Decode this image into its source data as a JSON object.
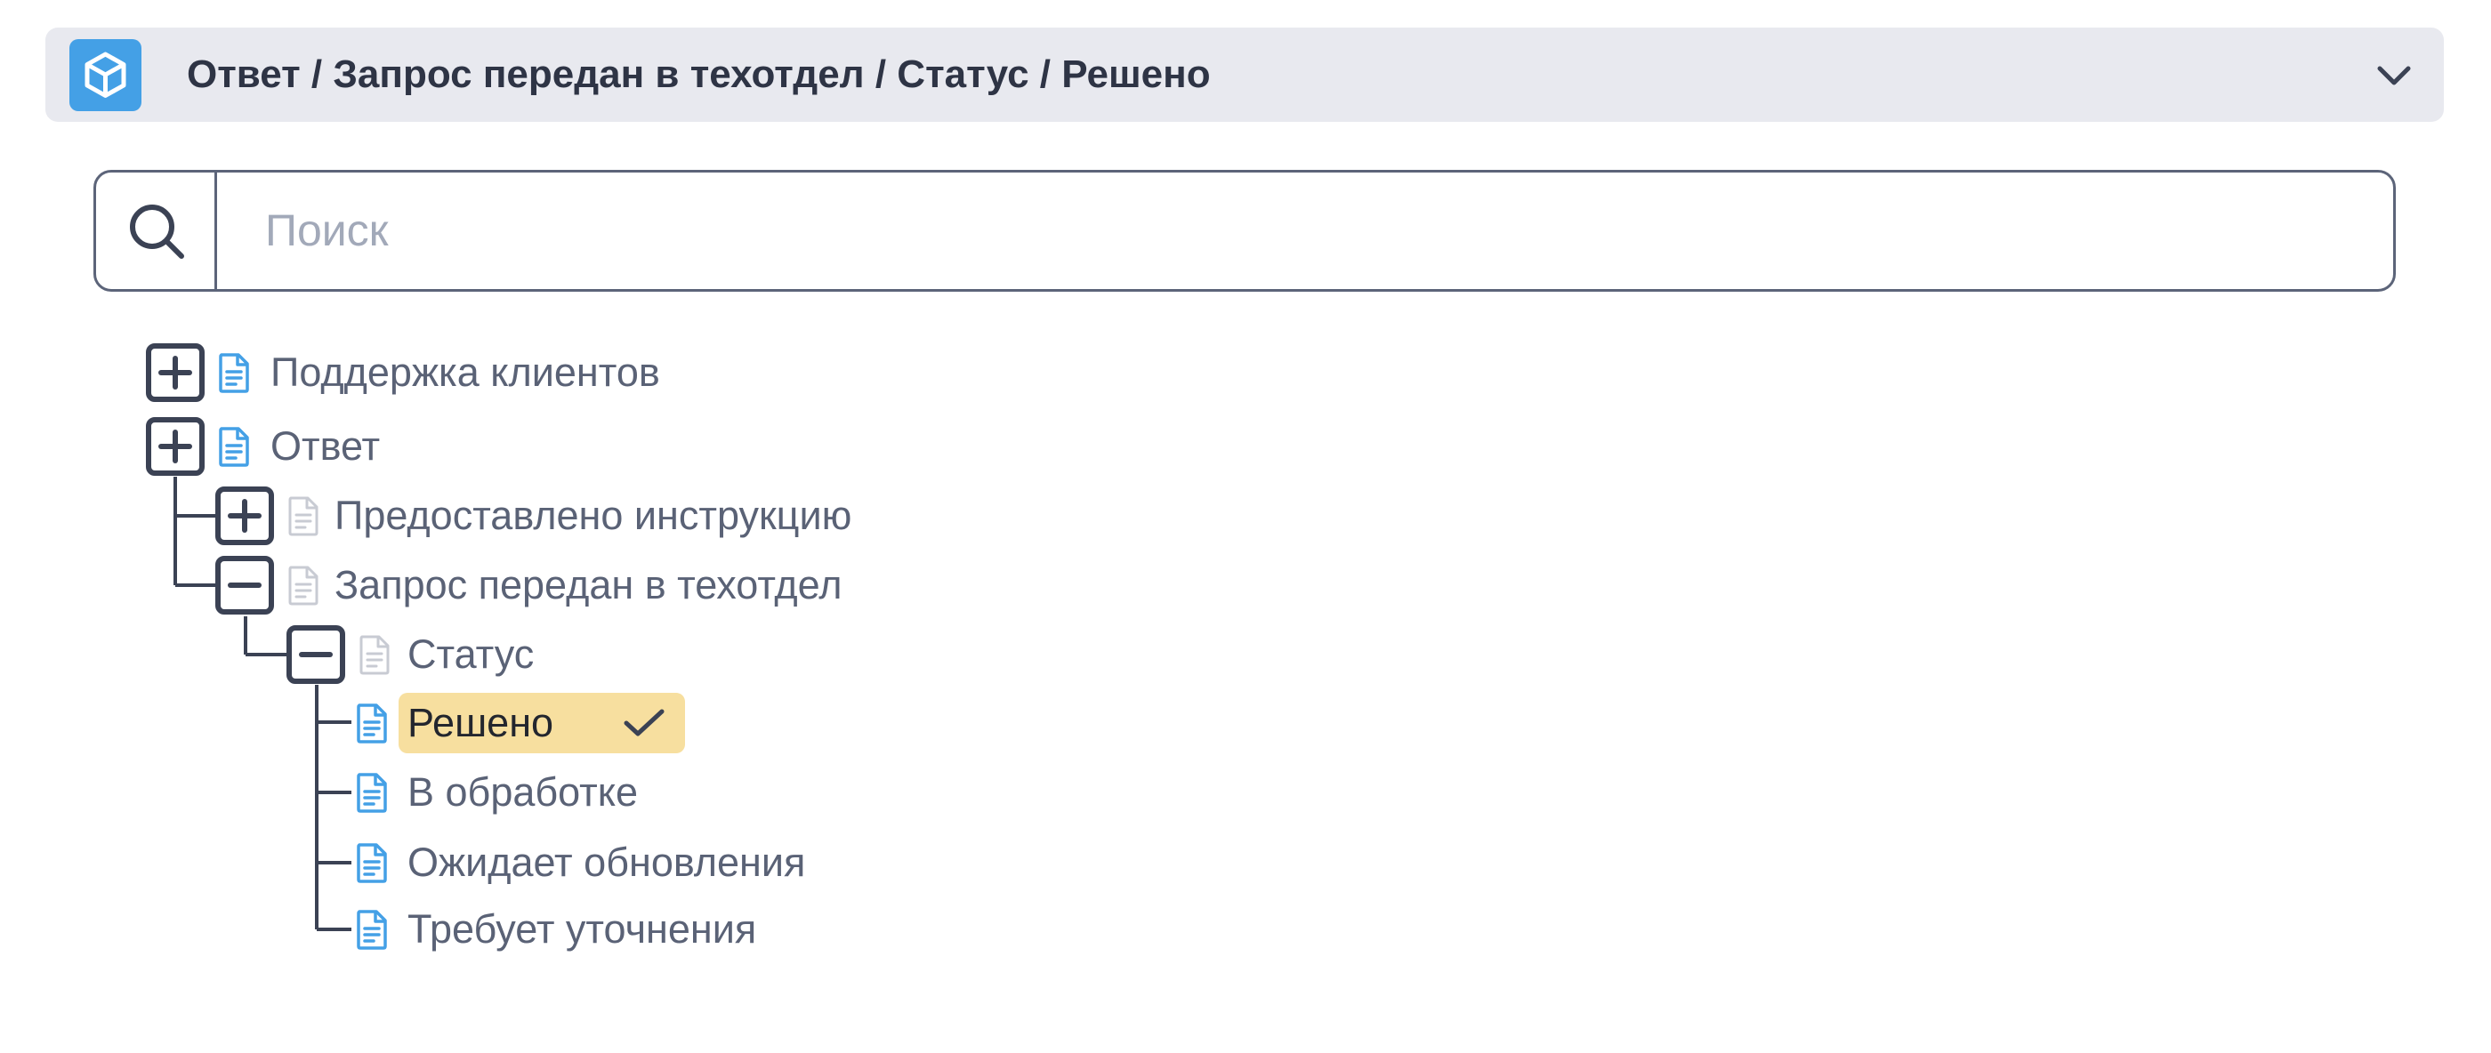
{
  "header": {
    "icon": "box-icon",
    "breadcrumb": "Ответ / Запрос передан в техотдел / Статус / Решено",
    "chevron_icon": "chevron-down-icon",
    "accent_color": "#44a0e6",
    "background_color": "#e8e9ef"
  },
  "search": {
    "icon": "search-icon",
    "placeholder": "Поиск",
    "value": ""
  },
  "tree": {
    "items": [
      {
        "label": "Поддержка клиентов",
        "state": "collapsed",
        "icon": "document-icon",
        "icon_color": "#44a0e6"
      },
      {
        "label": "Ответ",
        "state": "collapsed",
        "icon": "document-icon",
        "icon_color": "#44a0e6"
      },
      {
        "label": "Предоставлено инструкцию",
        "state": "collapsed",
        "icon": "document-icon",
        "icon_color": "#c8cbd3"
      },
      {
        "label": "Запрос передан в техотдел",
        "state": "expanded",
        "icon": "document-icon",
        "icon_color": "#c8cbd3"
      },
      {
        "label": "Статус",
        "state": "expanded",
        "icon": "document-icon",
        "icon_color": "#c8cbd3"
      },
      {
        "label": "Решено",
        "state": "leaf",
        "selected": true,
        "icon": "document-icon",
        "icon_color": "#44a0e6",
        "selected_icon": "checkmark-icon",
        "highlight_color": "#f7df9f"
      },
      {
        "label": "В обработке",
        "state": "leaf",
        "icon": "document-icon",
        "icon_color": "#44a0e6"
      },
      {
        "label": "Ожидает обновления",
        "state": "leaf",
        "icon": "document-icon",
        "icon_color": "#44a0e6"
      },
      {
        "label": "Требует уточнения",
        "state": "leaf",
        "icon": "document-icon",
        "icon_color": "#44a0e6"
      }
    ]
  }
}
